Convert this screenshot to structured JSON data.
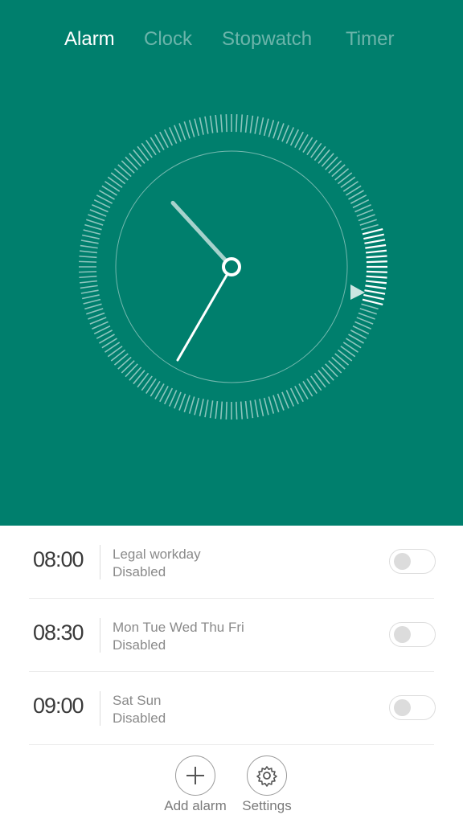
{
  "theme": {
    "accent": "#007f6d"
  },
  "tabs": [
    {
      "label": "Alarm",
      "active": true
    },
    {
      "label": "Clock",
      "active": false
    },
    {
      "label": "Stopwatch",
      "active": false
    },
    {
      "label": "Timer",
      "active": false
    }
  ],
  "clock": {
    "hour": 10,
    "minute": 35,
    "next_alarm_indicator": "triangle-marker-icon"
  },
  "alarms": [
    {
      "time": "08:00",
      "days": "Legal workday",
      "status": "Disabled",
      "enabled": false
    },
    {
      "time": "08:30",
      "days": "Mon Tue Wed Thu Fri",
      "status": "Disabled",
      "enabled": false
    },
    {
      "time": "09:00",
      "days": "Sat Sun",
      "status": "Disabled",
      "enabled": false
    }
  ],
  "actions": {
    "add_label": "Add alarm",
    "add_icon": "plus-icon",
    "settings_label": "Settings",
    "settings_icon": "gear-icon"
  }
}
